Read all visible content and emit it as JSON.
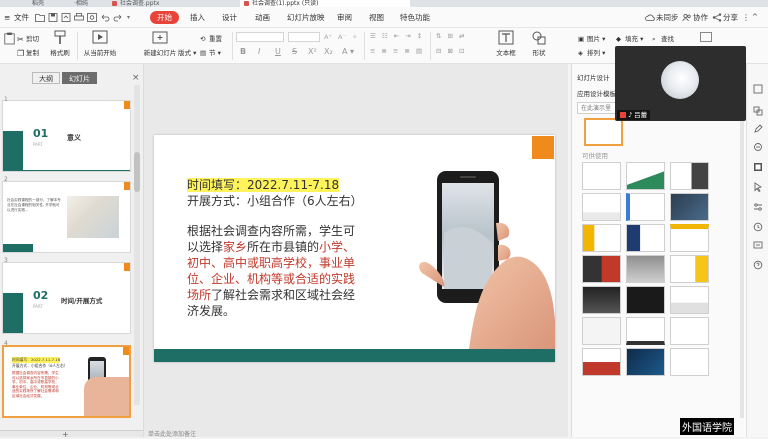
{
  "tabstrip": {
    "tab_first": "稻壳",
    "tab_second": "·相纯",
    "tab_third": "社会调查.pptx",
    "tab_active": "社会调查(1).pptx (只读)"
  },
  "menubar": {
    "file": "文件",
    "tabs": [
      "开始",
      "插入",
      "设计",
      "动画",
      "幻灯片放映",
      "审阅",
      "视图",
      "特色功能"
    ],
    "collaborate": "未同步",
    "coop": "协作",
    "share": "分享"
  },
  "ribbon": {
    "cut": "剪切",
    "copy": "复制",
    "format_painter": "格式刷",
    "play_from_current": "从当前开始",
    "new_slide": "新建幻灯片",
    "layout": "版式",
    "section": "节",
    "reset": "重置",
    "textbox": "文本框",
    "shape": "形状",
    "picture": "图片",
    "fill": "填充",
    "find": "查找",
    "arrange": "排列",
    "replace": "替换",
    "bold": "B",
    "italic": "I",
    "underline": "U",
    "strike": "S"
  },
  "left_panel": {
    "tab_outline": "大纲",
    "tab_slides": "幻灯片",
    "close": "×",
    "thumbs": [
      {
        "num": "1",
        "big": "01",
        "title": "意义",
        "sub": "PART"
      },
      {
        "num": "2",
        "text": "社会实践课程的一部分，了解本专业在社会课程的相关性, 开学就可以进行实践..."
      },
      {
        "num": "3",
        "big": "02",
        "title": "时间/开展方式",
        "sub": "PART"
      },
      {
        "num": "4",
        "l1": "时间填写：2022.7.11-7.18",
        "l2": "开展方式：小组合作（6人左右）",
        "body": "根据社会调查内容所需，学生可以选择家乡所在市县镇的小学、初中、高中或职高学校，事业单位、企业、机构等或合适的实践场所了解社会需求和区域社会经济发展。"
      }
    ]
  },
  "slide": {
    "line1": "时间填写：2022.7.11-7.18",
    "line2": "开展方式：小组合作（6人左右）",
    "body": [
      [
        {
          "t": "根据社会调查内容所需，学生可",
          "r": false
        }
      ],
      [
        {
          "t": "以选择",
          "r": false
        },
        {
          "t": "家乡",
          "r": true
        },
        {
          "t": "所在市县镇的",
          "r": false
        },
        {
          "t": "小学、",
          "r": true
        }
      ],
      [
        {
          "t": "初中、高中或职高学校，事业单",
          "r": true
        }
      ],
      [
        {
          "t": "位、企业、机构等或合适的实践",
          "r": true
        }
      ],
      [
        {
          "t": "场所",
          "r": true
        },
        {
          "t": "了解社会需求和区域社会经",
          "r": false
        }
      ],
      [
        {
          "t": "济发展。",
          "r": false
        }
      ]
    ]
  },
  "bottom_hint": "单击此处添加备注",
  "right_panel": {
    "title": "幻灯片设计",
    "apply_template": "应用设计模板",
    "search_placeholder": "在此演示里",
    "section_available": "可供使用",
    "templates": [
      "template-1",
      "template-2",
      "template-3",
      "template-4",
      "template-5",
      "template-6",
      "template-7",
      "template-8",
      "template-9",
      "template-10",
      "template-11",
      "template-12",
      "template-13",
      "template-14",
      "template-15",
      "template-16",
      "template-17",
      "template-18",
      "template-19",
      "template-20",
      "template-21"
    ]
  },
  "video": {
    "name": "吕蕾"
  },
  "watermark": "外国语学院",
  "colors": {
    "accent_red": "#e8443a",
    "teal": "#1f6e66",
    "orange": "#f08a1c",
    "highlight": "#fff35c",
    "text_red": "#c0392b"
  }
}
